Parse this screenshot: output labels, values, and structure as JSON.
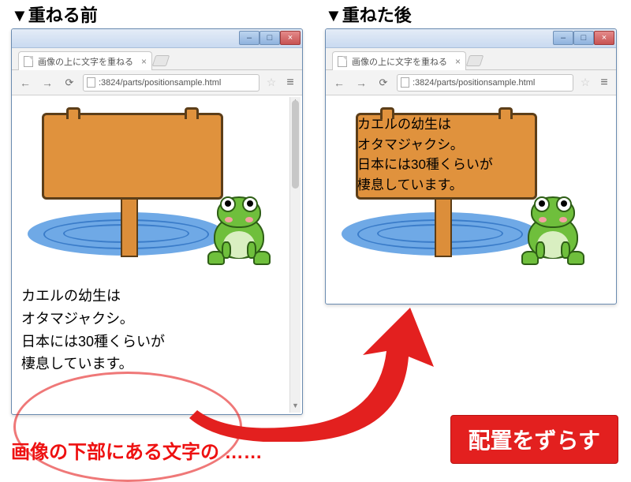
{
  "headings": {
    "before": "▼重ねる前",
    "after": "▼重ねた後"
  },
  "browser": {
    "tab_title": "画像の上に文字を重ねる",
    "url_display": ":3824/parts/positionsample.html",
    "tab_close_glyph": "×",
    "nav_back_glyph": "←",
    "nav_fwd_glyph": "→",
    "reload_glyph": "⟳",
    "star_glyph": "☆",
    "menu_glyph": "≡",
    "sys_min": "–",
    "sys_max": "□",
    "sys_close": "×",
    "scroll_up": "▲",
    "scroll_down": "▼"
  },
  "caption_text": "カエルの幼生は\nオタマジャクシ。\n日本には30種くらいが\n棲息しています。",
  "bottom_caption": "画像の下部にある文字の ……",
  "button_label": "配置をずらす"
}
